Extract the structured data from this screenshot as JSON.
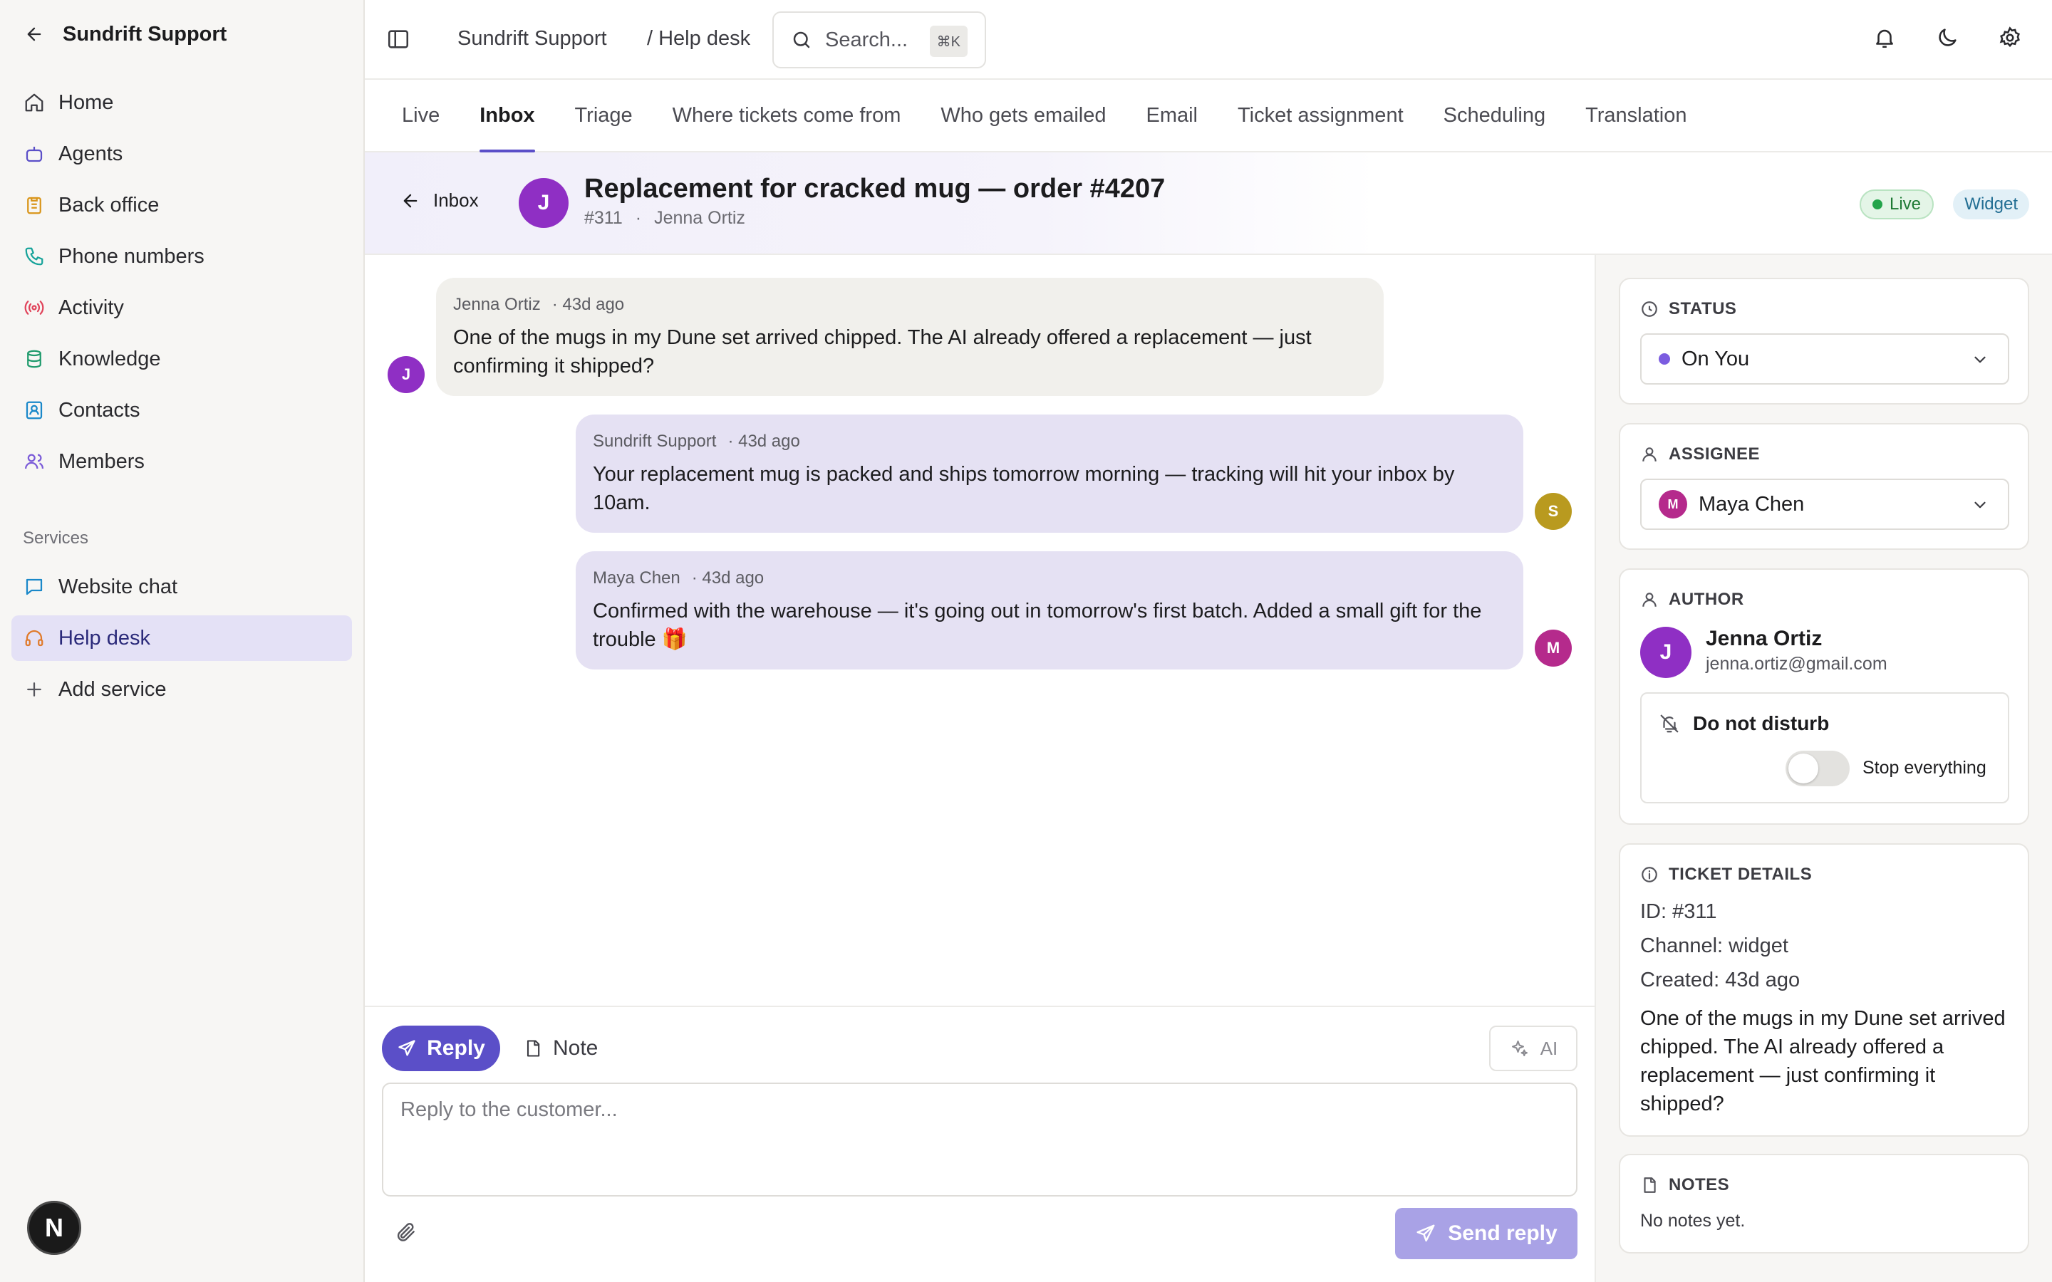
{
  "sidebar": {
    "title": "Sundrift Support",
    "nav": [
      {
        "label": "Home",
        "icon": "home-icon"
      },
      {
        "label": "Agents",
        "icon": "bot-icon"
      },
      {
        "label": "Back office",
        "icon": "clipboard-icon"
      },
      {
        "label": "Phone numbers",
        "icon": "phone-icon"
      },
      {
        "label": "Activity",
        "icon": "broadcast-icon"
      },
      {
        "label": "Knowledge",
        "icon": "database-icon"
      },
      {
        "label": "Contacts",
        "icon": "contact-icon"
      },
      {
        "label": "Members",
        "icon": "users-icon"
      }
    ],
    "section_label": "Services",
    "services": [
      {
        "label": "Website chat",
        "icon": "chat-icon"
      },
      {
        "label": "Help desk",
        "icon": "headset-icon",
        "active": true
      },
      {
        "label": "Add service",
        "icon": "plus-icon"
      }
    ],
    "user_initial": "N"
  },
  "topbar": {
    "breadcrumb_app": "Sundrift Support",
    "breadcrumb_page": "/ Help desk",
    "search_placeholder": "Search...",
    "search_shortcut": "⌘K"
  },
  "tabs": [
    {
      "label": "Live"
    },
    {
      "label": "Inbox",
      "active": true
    },
    {
      "label": "Triage"
    },
    {
      "label": "Where tickets come from"
    },
    {
      "label": "Who gets emailed"
    },
    {
      "label": "Email"
    },
    {
      "label": "Ticket assignment"
    },
    {
      "label": "Scheduling"
    },
    {
      "label": "Translation"
    }
  ],
  "ticket": {
    "back_label": "Inbox",
    "avatar_initial": "J",
    "title": "Replacement for cracked mug — order #4207",
    "number": "#311",
    "separator": "·",
    "customer": "Jenna Ortiz",
    "badge_live": "Live",
    "badge_widget": "Widget"
  },
  "messages": [
    {
      "author": "Jenna Ortiz",
      "time": "· 43d ago",
      "text": "One of the mugs in my Dune set arrived chipped. The AI already offered a replacement — just confirming it shipped?",
      "initial": "J",
      "color": "#8f2fc4"
    },
    {
      "author": "Sundrift Support",
      "time": "· 43d ago",
      "text": "Your replacement mug is packed and ships tomorrow morning — tracking will hit your inbox by 10am.",
      "initial": "S",
      "color": "#b99a1f"
    },
    {
      "author": "Maya Chen",
      "time": "· 43d ago",
      "text": "Confirmed with the warehouse — it's going out in tomorrow's first batch. Added a small gift for the trouble 🎁",
      "initial": "M",
      "color": "#b52a8c"
    }
  ],
  "composer": {
    "reply_label": "Reply",
    "note_label": "Note",
    "ai_label": "AI",
    "placeholder": "Reply to the customer...",
    "send_label": "Send reply"
  },
  "panel": {
    "status": {
      "heading": "STATUS",
      "value": "On You",
      "dot_color": "#7b5ce0"
    },
    "assignee": {
      "heading": "ASSIGNEE",
      "value": "Maya Chen",
      "initial": "M"
    },
    "author": {
      "heading": "AUTHOR",
      "initial": "J",
      "name": "Jenna Ortiz",
      "email": "jenna.ortiz@gmail.com",
      "dnd_label": "Do not disturb",
      "toggle_label": "Stop everything",
      "toggle_on": false
    },
    "details": {
      "heading": "TICKET DETAILS",
      "id": "ID: #311",
      "channel": "Channel: widget",
      "created": "Created: 43d ago",
      "description": "One of the mugs in my Dune set arrived chipped. The AI already offered a replacement — just confirming it shipped?"
    },
    "notes": {
      "heading": "NOTES",
      "empty": "No notes yet."
    }
  },
  "colors": {
    "accent": "#5b4fc8",
    "live_green": "#23a44a"
  }
}
